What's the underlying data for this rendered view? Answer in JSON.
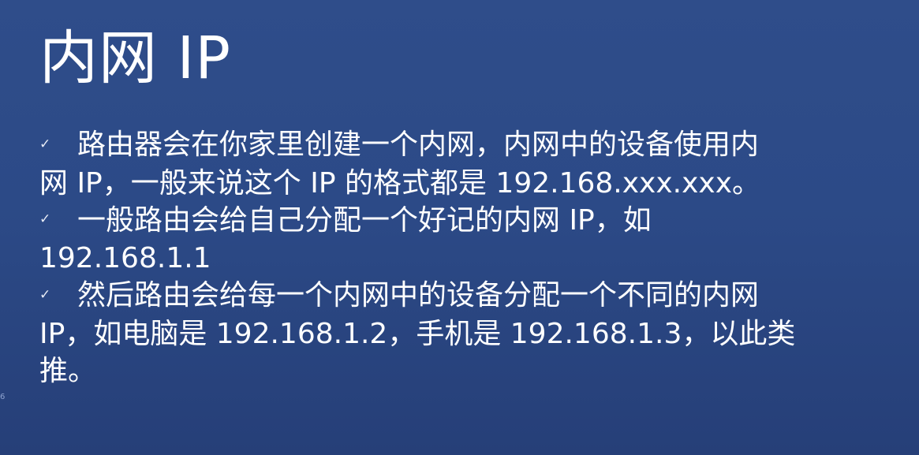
{
  "slide": {
    "title": "内网 IP",
    "bullets": [
      {
        "icon": "check-icon",
        "marker": "✓",
        "line1": "路由器会在你家里创建一个内网，内网中的设备使用内",
        "line2": "网 IP，一般来说这个 IP 的格式都是 192.168.xxx.xxx。"
      },
      {
        "icon": "check-icon",
        "marker": "✓",
        "line1": "一般路由会给自己分配一个好记的内网 IP，如",
        "line2": "192.168.1.1"
      },
      {
        "icon": "check-icon",
        "marker": "✓",
        "line1": "然后路由会给每一个内网中的设备分配一个不同的内网",
        "line2": "IP，如电脑是 192.168.1.2，手机是 192.168.1.3，以此类",
        "line3": "推。"
      }
    ],
    "page_number": "6"
  }
}
